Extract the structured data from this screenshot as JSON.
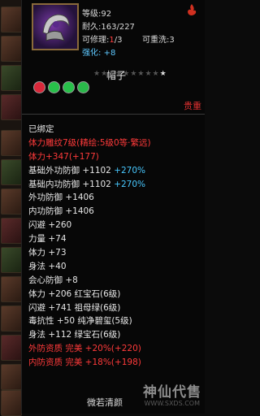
{
  "item": {
    "level_label": "等级:",
    "level_value": "92",
    "durability_label": "耐久:",
    "durability_value": "163/227",
    "repairable_label": "可修理:",
    "repairable_value": "1",
    "repairable_total": "/3",
    "reforge_label": "可重洗:",
    "reforge_value": "3",
    "enhance_label": "强化:",
    "enhance_value": "+8",
    "name": "帽子",
    "rarity": "贵重",
    "stars_total": 10,
    "stars_lit": 0
  },
  "gems": [
    {
      "name": "red-gem",
      "color": "#d8283a"
    },
    {
      "name": "green-gem",
      "color": "#28c04a"
    },
    {
      "name": "green-gem",
      "color": "#28c04a"
    },
    {
      "name": "green-gem",
      "color": "#2ab84a"
    }
  ],
  "lines": [
    {
      "text": "已绑定",
      "color": "white"
    },
    {
      "text": "体力雕纹7级(精绘:5级0等·繁远)",
      "color": "red"
    },
    {
      "text": "体力+347(+177)",
      "color": "red"
    },
    {
      "text": "基础外功防御 +1102 +270%",
      "color": "white",
      "extra": "+270%",
      "extra_color": "blue",
      "main": "基础外功防御 +1102"
    },
    {
      "text": "基础内功防御 +1102 +270%",
      "color": "white",
      "extra": "+270%",
      "extra_color": "blue",
      "main": "基础内功防御 +1102"
    },
    {
      "text": "外功防御 +1406",
      "color": "white"
    },
    {
      "text": "内功防御 +1406",
      "color": "white"
    },
    {
      "text": "闪避 +260",
      "color": "white"
    },
    {
      "text": "力量 +74",
      "color": "white"
    },
    {
      "text": "体力 +73",
      "color": "white"
    },
    {
      "text": "身法 +40",
      "color": "white"
    },
    {
      "text": "会心防御 +8",
      "color": "white"
    },
    {
      "text": "体力 +206 红宝石(6级)",
      "color": "white"
    },
    {
      "text": "闪避 +741 祖母绿(6级)",
      "color": "white"
    },
    {
      "text": "毒抗性 +50 纯净碧玺(5级)",
      "color": "white"
    },
    {
      "text": "身法 +112 绿宝石(6级)",
      "color": "white"
    },
    {
      "text": "外防资质  完美 +20%(+220)",
      "color": "red"
    },
    {
      "text": "内防资质  完美 +18%(+198)",
      "color": "red"
    }
  ],
  "footer": "微若清颜",
  "watermark": {
    "text": "神仙代售",
    "url": "WWW.SXDS.COM"
  },
  "colors": {
    "red": "#ff3a3a",
    "white": "#e6e6e6",
    "blue": "#48c8ff",
    "gold_border": "#8a6a3a"
  }
}
